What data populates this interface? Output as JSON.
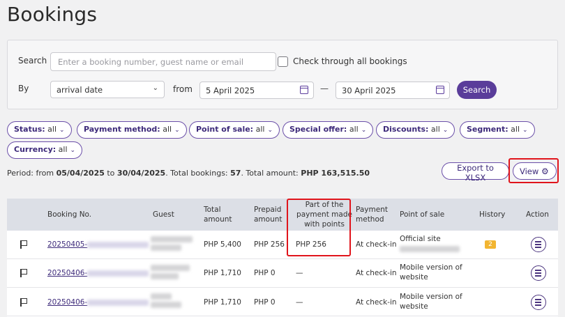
{
  "page": {
    "title": "Bookings"
  },
  "search": {
    "label": "Search",
    "placeholder": "Enter a booking number, guest name or email",
    "check_all_label": "Check through all bookings",
    "by_label": "By",
    "by_value": "arrival date",
    "from_label": "from",
    "date_from": "5 April 2025",
    "date_separator": "—",
    "date_to": "30 April 2025",
    "button": "Search"
  },
  "filters": [
    {
      "label": "Status:",
      "value": "all"
    },
    {
      "label": "Payment method:",
      "value": "all"
    },
    {
      "label": "Point of sale:",
      "value": "all"
    },
    {
      "label": "Special offer:",
      "value": "all"
    },
    {
      "label": "Discounts:",
      "value": "all"
    },
    {
      "label": "Segment:",
      "value": "all"
    },
    {
      "label": "Currency:",
      "value": "all"
    }
  ],
  "summary": {
    "prefix": "Period: from ",
    "from": "05/04/2025",
    "to_word": " to ",
    "to": "30/04/2025",
    "bookings_text": ". Total bookings: ",
    "bookings": "57",
    "amount_text": ". Total amount: ",
    "amount": "PHP 163,515.50"
  },
  "actions": {
    "export": "Export to XLSX",
    "view": "View"
  },
  "table": {
    "headers": {
      "booking_no": "Booking No.",
      "guest": "Guest",
      "total": "Total amount",
      "prepaid": "Prepaid amount",
      "points": "Part of the payment made with points",
      "payment": "Payment method",
      "pos": "Point of sale",
      "history": "History",
      "action": "Action"
    },
    "rows": [
      {
        "booking_prefix": "20250405-",
        "total": "PHP 5,400",
        "prepaid": "PHP 256",
        "points": "PHP 256",
        "payment": "At check-in",
        "pos": "Official site",
        "history": "2"
      },
      {
        "booking_prefix": "20250406-",
        "total": "PHP 1,710",
        "prepaid": "PHP 0",
        "points": "—",
        "payment": "At check-in",
        "pos": "Mobile version of website",
        "history": ""
      },
      {
        "booking_prefix": "20250406-",
        "total": "PHP 1,710",
        "prepaid": "PHP 0",
        "points": "—",
        "payment": "At check-in",
        "pos": "Mobile version of website",
        "history": ""
      }
    ]
  },
  "colors": {
    "accent": "#5a3d9a",
    "highlight": "#e0141b",
    "badge": "#f2b531"
  }
}
